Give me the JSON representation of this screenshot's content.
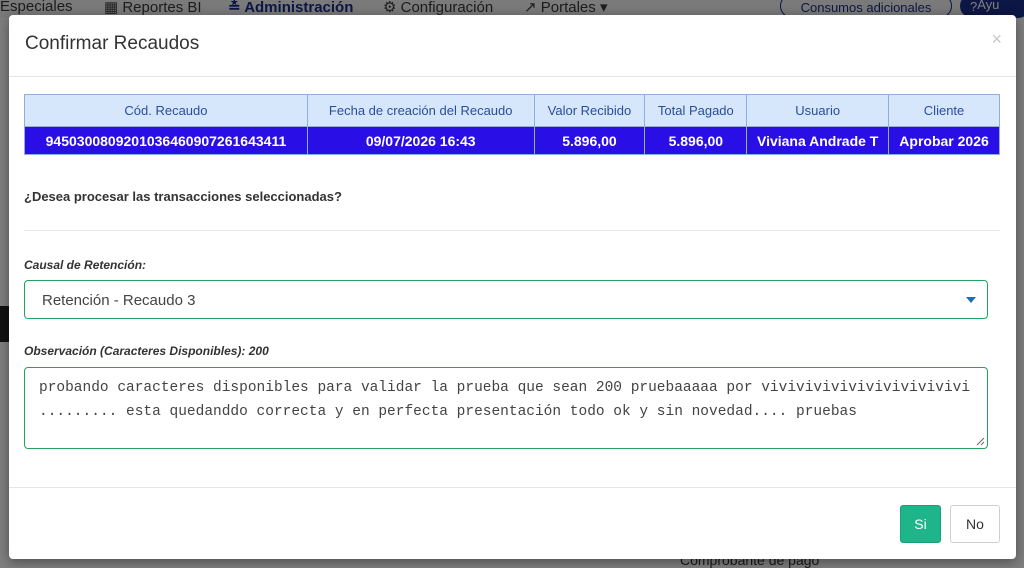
{
  "background": {
    "nav": {
      "especiales": "Especiales",
      "reportes_bi": "Reportes BI",
      "administracion": "Administración",
      "configuracion": "Configuración",
      "portales": "Portales",
      "consumos": "Consumos adicionales",
      "ayuda": "Ayu"
    },
    "bottom_text": "Comprobante de pago"
  },
  "modal": {
    "title": "Confirmar Recaudos",
    "close_symbol": "×",
    "table": {
      "headers": [
        "Cód. Recaudo",
        "Fecha de creación del Recaudo",
        "Valor Recibido",
        "Total Pagado",
        "Usuario",
        "Cliente"
      ],
      "rows": [
        [
          "9450300809201036460907261643411",
          "09/07/2026 16:43",
          "5.896,00",
          "5.896,00",
          "Viviana Andrade T",
          "Aprobar 2026"
        ]
      ]
    },
    "question": "¿Desea procesar las transacciones seleccionadas?",
    "causal_label": "Causal de Retención:",
    "causal_value": "Retención - Recaudo 3",
    "observacion_label": "Observación (Caracteres Disponibles): 200",
    "observacion_value": "probando caracteres disponibles para validar la prueba que sean 200 pruebaaaaa por vivivivivivivivivivivivi ......... esta quedanddo correcta y en perfecta presentación todo ok y sin novedad.... pruebas",
    "buttons": {
      "si": "Si",
      "no": "No"
    }
  },
  "colors": {
    "row_selected": "#2a0ee6",
    "header_bg": "#d6e6fb",
    "accent_green": "#1fb58b",
    "title_blue": "#1a2f8a"
  }
}
